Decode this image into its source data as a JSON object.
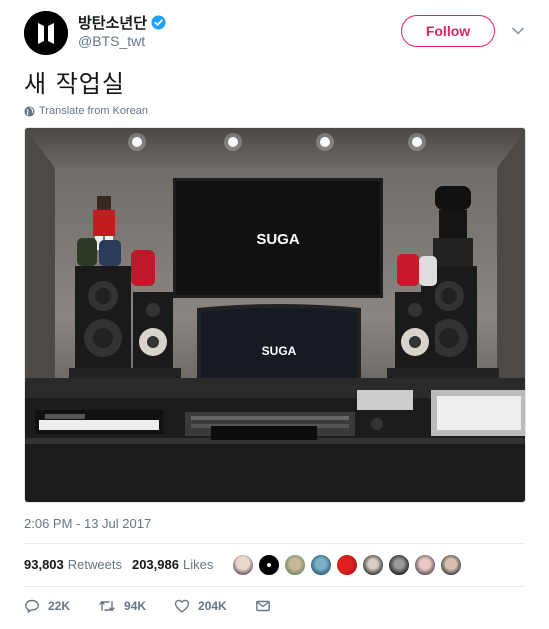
{
  "account": {
    "display_name": "방탄소년단",
    "handle": "@BTS_twt",
    "verified": true
  },
  "follow_label": "Follow",
  "tweet": {
    "text": "새 작업실",
    "translate_label": "Translate from Korean"
  },
  "photo": {
    "screen_label_top": "SUGA",
    "screen_label_bottom": "SUGA"
  },
  "timestamp": "2:06 PM - 13 Jul 2017",
  "stats": {
    "retweets_count": "93,803",
    "retweets_label": "Retweets",
    "likes_count": "203,986",
    "likes_label": "Likes"
  },
  "actions": {
    "reply_count": "22K",
    "retweet_count": "94K",
    "like_count": "204K"
  },
  "colors": {
    "accent": "#e0245e",
    "verified": "#1da1f2",
    "muted": "#657786"
  }
}
